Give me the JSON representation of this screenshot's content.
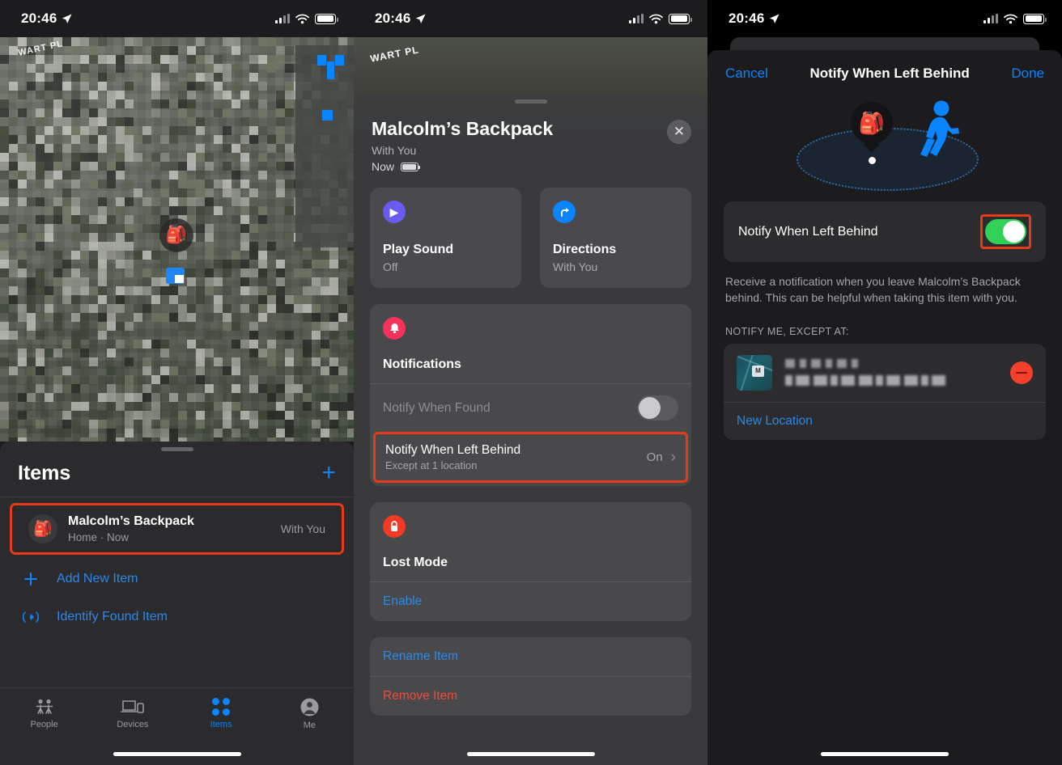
{
  "statusbar": {
    "time": "20:46",
    "icons": [
      "location-arrow",
      "cellular-signal",
      "wifi",
      "battery"
    ]
  },
  "panel1": {
    "map": {
      "street_label": "WART PL",
      "pin_icon": "backpack-pin",
      "user_location_icon": "user-location-marker"
    },
    "items_header": {
      "title": "Items",
      "add_label": "+"
    },
    "item": {
      "avatar_icon": "backpack-avatar",
      "name": "Malcolm’s Backpack",
      "subtitle": "Home · Now",
      "status": "With You"
    },
    "add_new_item": {
      "label": "Add New Item",
      "icon": "plus-icon"
    },
    "identify_found_item": {
      "label": "Identify Found Item",
      "icon": "signal-waves-icon"
    },
    "tabs": [
      {
        "label": "People",
        "icon": "people-icon",
        "selected": false
      },
      {
        "label": "Devices",
        "icon": "devices-icon",
        "selected": false
      },
      {
        "label": "Items",
        "icon": "items-dots-icon",
        "selected": true
      },
      {
        "label": "Me",
        "icon": "person-circle-icon",
        "selected": false
      }
    ]
  },
  "panel2": {
    "map_street_label": "WART PL",
    "sheet": {
      "title": "Malcolm’s Backpack",
      "subtitle": "With You",
      "timestamp": "Now",
      "close_label": "✕"
    },
    "action_cards": [
      {
        "title": "Play Sound",
        "subtitle": "Off",
        "icon": "play-icon",
        "color": "#6a5bf0"
      },
      {
        "title": "Directions",
        "subtitle": "With You",
        "icon": "directions-arrow-icon",
        "color": "#0a84ff"
      }
    ],
    "notifications": {
      "icon": "bell-icon",
      "color": "#f5315c",
      "title": "Notifications",
      "rows": [
        {
          "label": "Notify When Found",
          "control": "toggle-off",
          "disabled": true
        },
        {
          "label": "Notify When Left Behind",
          "sublabel": "Except at 1 location",
          "value": "On",
          "chevron": "›",
          "highlighted": true
        }
      ]
    },
    "lost_mode": {
      "icon": "lock-icon",
      "color": "#f33a25",
      "title": "Lost Mode",
      "action": "Enable"
    },
    "actions": [
      {
        "label": "Rename Item",
        "style": "blue"
      },
      {
        "label": "Remove Item",
        "style": "red"
      }
    ]
  },
  "panel3": {
    "nav": {
      "cancel": "Cancel",
      "title": "Notify When Left Behind",
      "done": "Done"
    },
    "illustration": {
      "item_icon": "backpack-pin",
      "person_icon": "walking-person-icon",
      "radius_icon": "dotted-ellipse"
    },
    "toggle_row": {
      "label": "Notify When Left Behind",
      "state": "on",
      "color": "#31d158"
    },
    "description": "Receive a notification when you leave Malcolm’s Backpack behind. This can be helpful when taking this item with you.",
    "section_header": "NOTIFY ME, EXCEPT AT:",
    "location_row": {
      "thumbnail_badge": "M",
      "name_redacted": true,
      "address_redacted": true,
      "delete_icon": "minus-circle-icon"
    },
    "new_location": "New Location"
  },
  "annotations": {
    "highlight_color": "#e8391b"
  }
}
